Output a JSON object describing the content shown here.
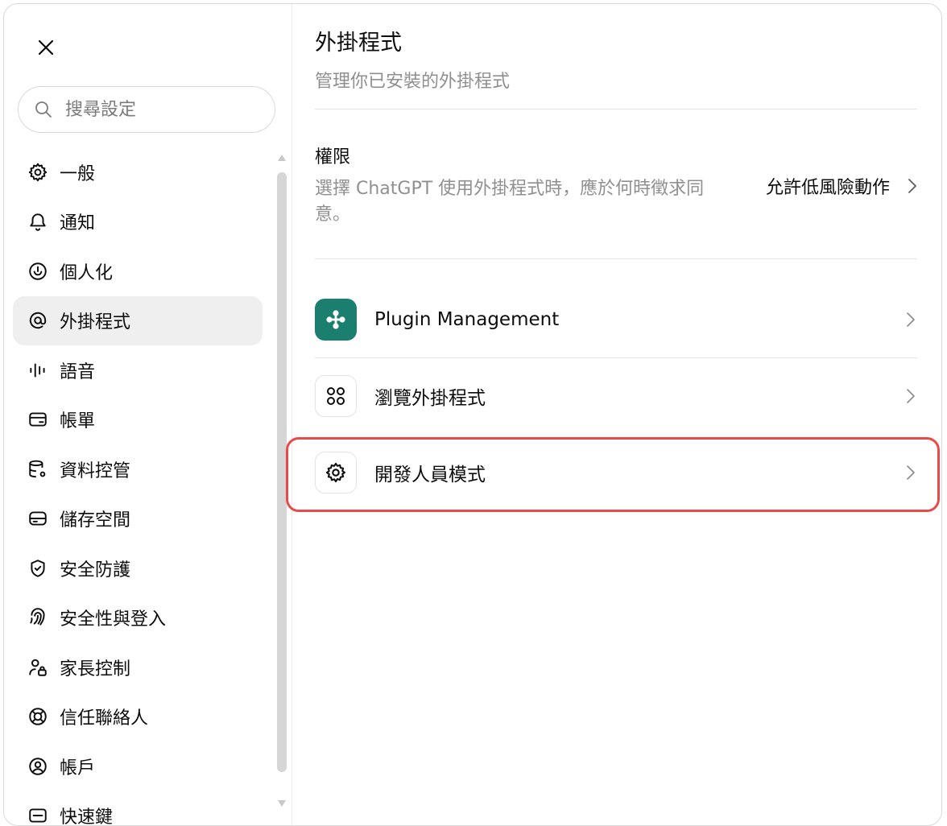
{
  "search": {
    "placeholder": "搜尋設定"
  },
  "nav": [
    {
      "label": "一般",
      "icon": "gear-icon",
      "active": false
    },
    {
      "label": "通知",
      "icon": "bell-icon",
      "active": false
    },
    {
      "label": "個人化",
      "icon": "personalization-icon",
      "active": false
    },
    {
      "label": "外掛程式",
      "icon": "at-sign-icon",
      "active": true
    },
    {
      "label": "語音",
      "icon": "waveform-icon",
      "active": false
    },
    {
      "label": "帳單",
      "icon": "credit-card-icon",
      "active": false
    },
    {
      "label": "資料控管",
      "icon": "database-icon",
      "active": false
    },
    {
      "label": "儲存空間",
      "icon": "storage-icon",
      "active": false
    },
    {
      "label": "安全防護",
      "icon": "shield-check-icon",
      "active": false
    },
    {
      "label": "安全性與登入",
      "icon": "fingerprint-icon",
      "active": false
    },
    {
      "label": "家長控制",
      "icon": "parental-lock-icon",
      "active": false
    },
    {
      "label": "信任聯絡人",
      "icon": "lifebuoy-icon",
      "active": false
    },
    {
      "label": "帳戶",
      "icon": "user-circle-icon",
      "active": false
    },
    {
      "label": "快速鍵",
      "icon": "keyboard-icon",
      "active": false
    }
  ],
  "page": {
    "title": "外掛程式",
    "subtitle": "管理你已安裝的外掛程式"
  },
  "permissions": {
    "title": "權限",
    "description": "選擇 ChatGPT 使用外掛程式時，應於何時徵求同意。",
    "value": "允許低風險動作"
  },
  "rows": [
    {
      "label": "Plugin Management",
      "icon": "plugin-management-icon"
    },
    {
      "label": "瀏覽外掛程式",
      "icon": "grid-dots-icon"
    },
    {
      "label": "開發人員模式",
      "icon": "gear-icon"
    }
  ],
  "colors": {
    "accent_green": "#1a7f6e",
    "highlight_red": "#e84a4a"
  }
}
